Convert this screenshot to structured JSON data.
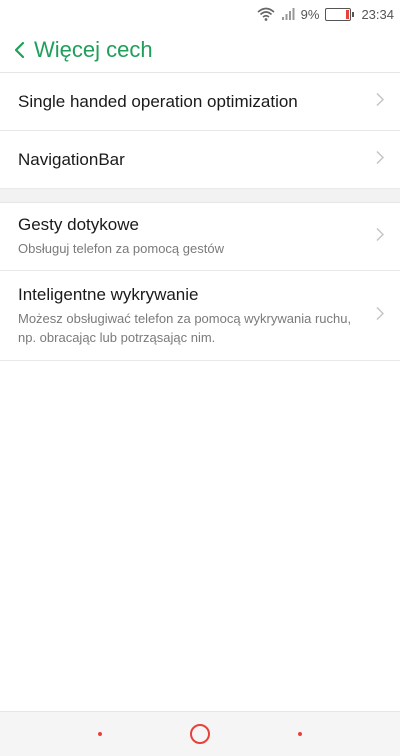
{
  "status_bar": {
    "battery_percent": "9%",
    "time": "23:34",
    "icons": [
      "wifi-icon",
      "signal-icon",
      "battery-icon"
    ]
  },
  "header": {
    "title": "Więcej cech",
    "back_icon": "chevron-left-icon"
  },
  "section1": [
    {
      "label": "Single handed operation optimization"
    },
    {
      "label": "NavigationBar"
    }
  ],
  "section2": [
    {
      "label": "Gesty dotykowe",
      "sub": "Obsługuj telefon za pomocą gestów"
    },
    {
      "label": "Inteligentne wykrywanie",
      "sub": "Możesz obsługiwać telefon za pomocą wykrywania ruchu, np. obracając lub potrząsając nim."
    }
  ],
  "colors": {
    "accent": "#1f9f5a",
    "nav_accent": "#e8413a"
  },
  "nav": {
    "buttons": [
      "menu-dot",
      "home-circle",
      "back-dot"
    ]
  }
}
